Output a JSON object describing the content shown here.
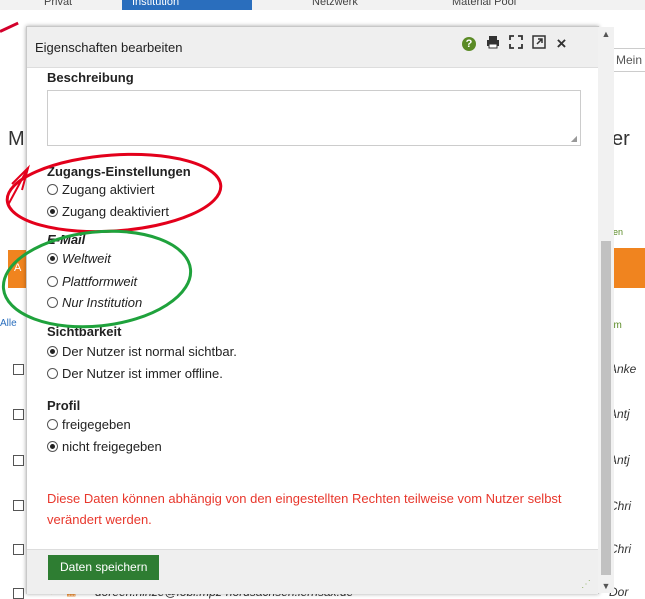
{
  "background": {
    "tabs": [
      "Privat",
      "Institution",
      "Netzwerk",
      "Material Pool"
    ],
    "right_fragments": [
      "Mein",
      "er",
      "ren",
      "am",
      "Anke",
      "Antj",
      "Antj",
      "Chri",
      "Chri",
      "Dor"
    ],
    "left_fragments": [
      "M",
      "A",
      "Alle"
    ],
    "bottom_email": "doreen.hinze@fobi.mpz-nordsachsen.lernsax.de"
  },
  "modal": {
    "title": "Eigenschaften bearbeiten",
    "toolbar": {
      "help": "?",
      "print": "print-icon",
      "fullscreen": "fullscreen-icon",
      "external": "external-link-icon",
      "close": "×"
    },
    "beschreibung": {
      "label": "Beschreibung",
      "value": ""
    },
    "zugang": {
      "label": "Zugangs-Einstellungen",
      "options": [
        "Zugang aktiviert",
        "Zugang deaktiviert"
      ],
      "selected": 1
    },
    "email": {
      "label": "E-Mail",
      "options": [
        "Weltweit",
        "Plattformweit",
        "Nur Institution"
      ],
      "selected": 0
    },
    "sichtbarkeit": {
      "label": "Sichtbarkeit",
      "options": [
        "Der Nutzer ist normal sichtbar.",
        "Der Nutzer ist immer offline."
      ],
      "selected": 0
    },
    "profil": {
      "label": "Profil",
      "options": [
        "freigegeben",
        "nicht freigegeben"
      ],
      "selected": 1
    },
    "notice": "Diese Daten können abhängig von den eingestellten Rechten teilweise vom Nutzer selbst verändert werden.",
    "save_label": "Daten speichern"
  },
  "colors": {
    "annotation_red": "#e3001b",
    "annotation_green": "#1fa23c",
    "save_button": "#2e7d32",
    "notice_text": "#e8372c",
    "orange_bar": "#f0841f"
  }
}
